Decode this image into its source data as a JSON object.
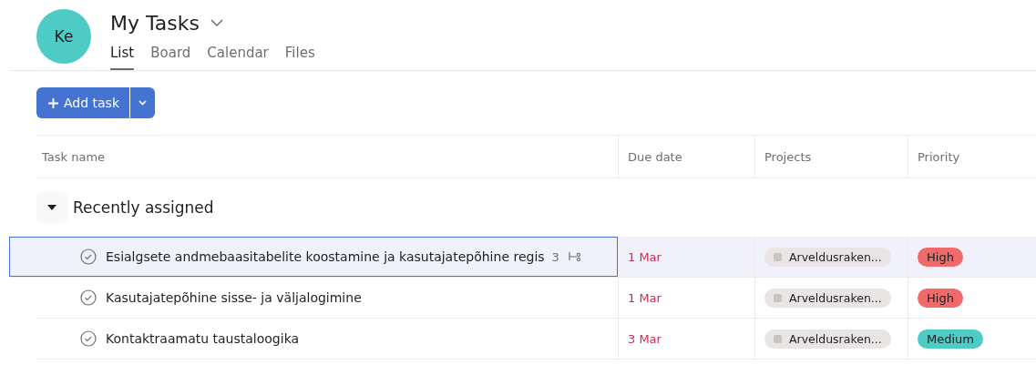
{
  "header": {
    "avatar": "Ke",
    "title": "My Tasks"
  },
  "tabs": [
    {
      "label": "List",
      "selected": true
    },
    {
      "label": "Board",
      "selected": false
    },
    {
      "label": "Calendar",
      "selected": false
    },
    {
      "label": "Files",
      "selected": false
    }
  ],
  "add_button": {
    "label": "Add task"
  },
  "table": {
    "columns": [
      "Task name",
      "Due date",
      "Projects",
      "Priority"
    ],
    "group": {
      "title": "Recently assigned",
      "expanded": true
    },
    "rows": [
      {
        "name": "Esialgsete andmebaasitabelite koostamine ja kasutajatepõhine regis",
        "subtasks": "3",
        "selected": true,
        "due": "1 Mar",
        "project": "Arveldusraken...",
        "priority": "High",
        "color": "#f06a6a"
      },
      {
        "name": "Kasutajatepõhine sisse- ja väljalogimine",
        "selected": false,
        "due": "1 Mar",
        "project": "Arveldusraken...",
        "priority": "High",
        "color": "#f06a6a"
      },
      {
        "name": "Kontaktraamatu taustaloogika",
        "selected": false,
        "due": "3 Mar",
        "project": "Arveldusraken...",
        "priority": "Medium",
        "color": "#4ecbc4"
      }
    ]
  }
}
